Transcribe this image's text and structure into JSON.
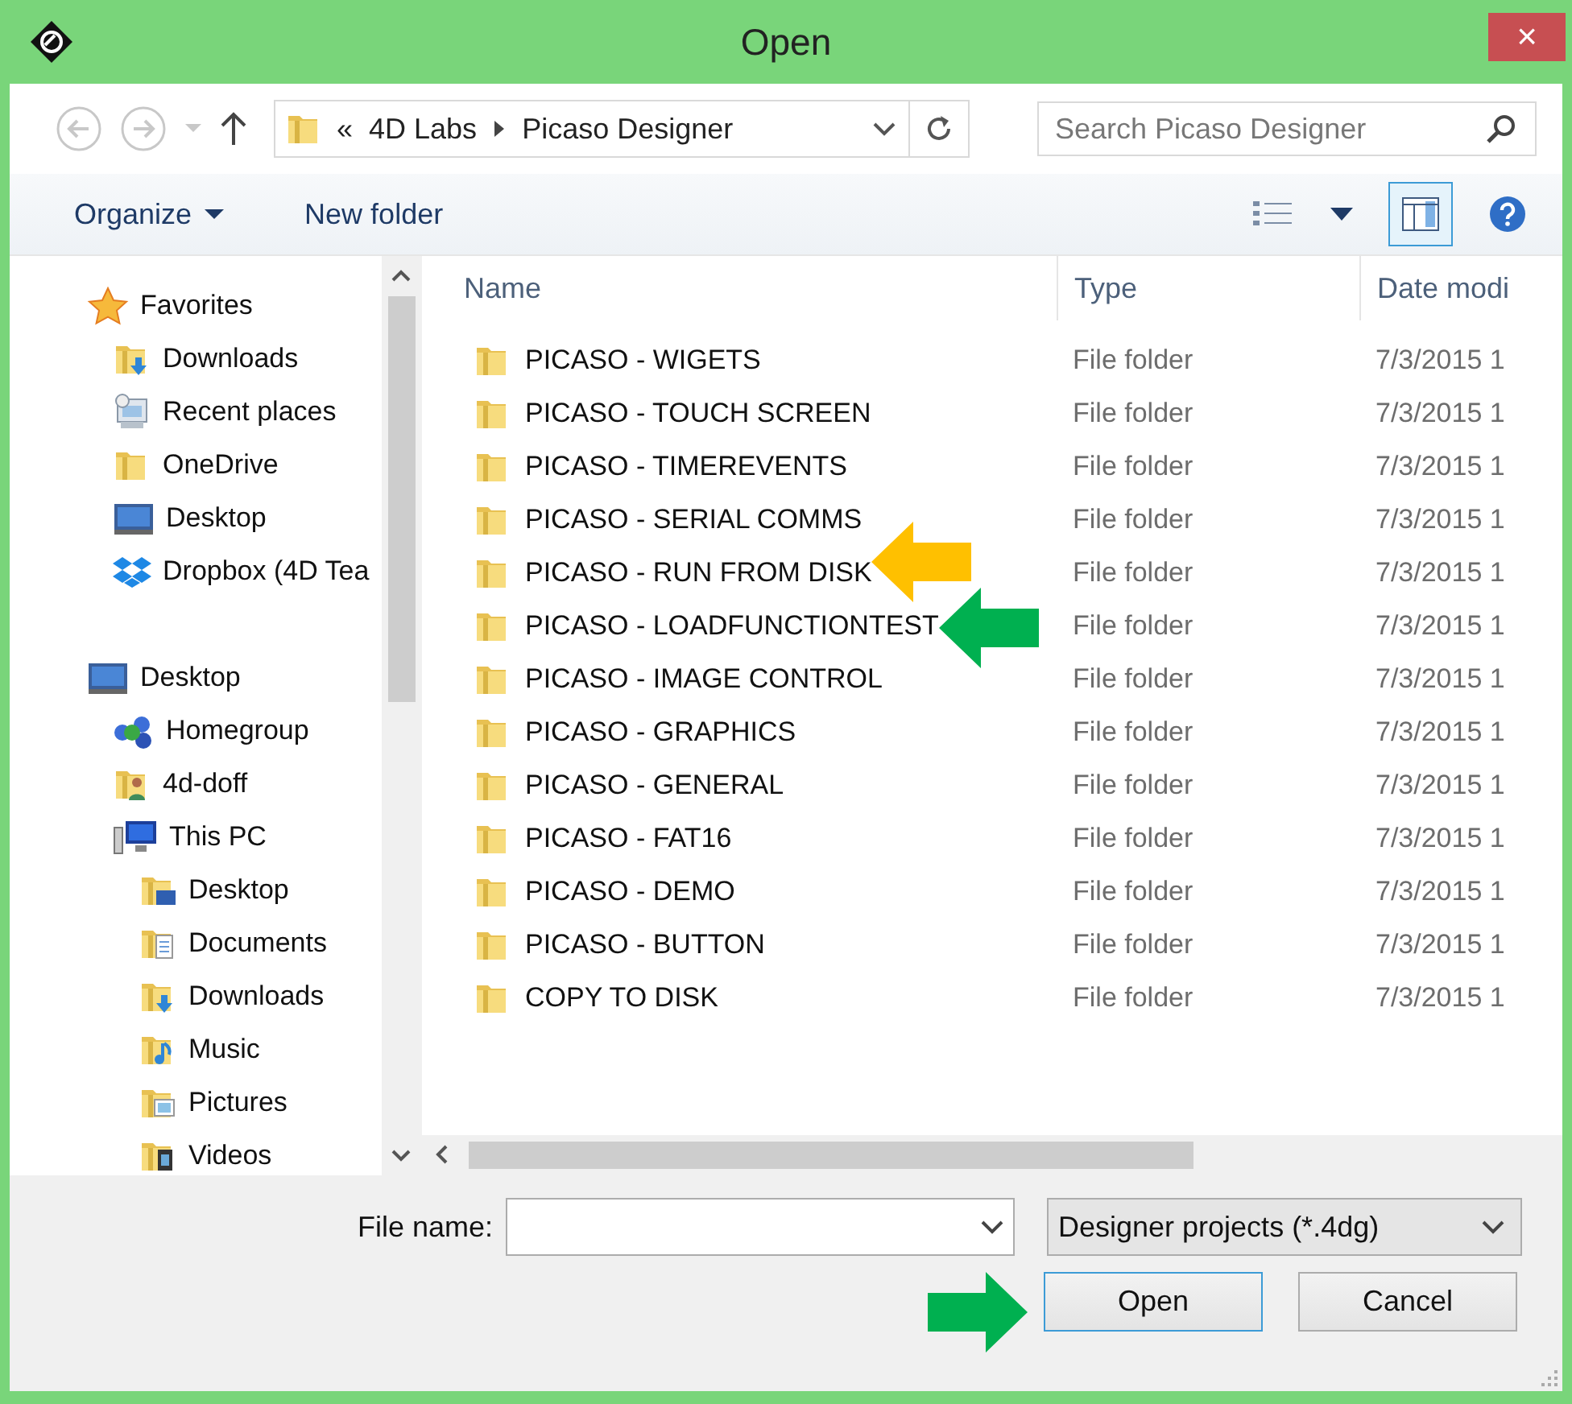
{
  "window": {
    "title": "Open",
    "close": "×"
  },
  "navigation": {
    "path": [
      "«",
      "4D Labs",
      "Picaso Designer"
    ],
    "search": {
      "placeholder": "Search Picaso Designer"
    }
  },
  "toolbar": {
    "items": [
      "Organize",
      "New folder"
    ]
  },
  "sidebar": {
    "items": [
      {
        "label": "Favorites",
        "kind": "star",
        "children": [
          {
            "label": "Downloads",
            "kind": "download"
          },
          {
            "label": "Recent places",
            "kind": "recent"
          },
          {
            "label": "OneDrive",
            "kind": "folder"
          },
          {
            "label": "Desktop",
            "kind": "monitor"
          },
          {
            "label": "Dropbox (4D Tea",
            "kind": "dropbox"
          }
        ]
      },
      {
        "label": "Desktop",
        "kind": "monitor",
        "children": [
          {
            "label": "Homegroup",
            "kind": "homegroup"
          },
          {
            "label": "4d-doff",
            "kind": "user"
          },
          {
            "label": "This PC",
            "kind": "pc",
            "children": [
              {
                "label": "Desktop",
                "kind": "monitor-folder"
              },
              {
                "label": "Documents",
                "kind": "documents"
              },
              {
                "label": "Downloads",
                "kind": "download"
              },
              {
                "label": "Music",
                "kind": "music"
              },
              {
                "label": "Pictures",
                "kind": "pictures"
              },
              {
                "label": "Videos",
                "kind": "videos"
              }
            ]
          }
        ]
      }
    ]
  },
  "table": {
    "columns": [
      "Name",
      "Type",
      "Date modi"
    ],
    "rows": [
      {
        "name": "PICASO - WIGETS",
        "type": "File folder",
        "date": "7/3/2015 1"
      },
      {
        "name": "PICASO - TOUCH SCREEN",
        "type": "File folder",
        "date": "7/3/2015 1"
      },
      {
        "name": "PICASO - TIMEREVENTS",
        "type": "File folder",
        "date": "7/3/2015 1"
      },
      {
        "name": "PICASO - SERIAL COMMS",
        "type": "File folder",
        "date": "7/3/2015 1"
      },
      {
        "name": "PICASO - RUN FROM DISK",
        "type": "File folder",
        "date": "7/3/2015 1",
        "arrow": {
          "color": "#ffc000"
        }
      },
      {
        "name": "PICASO - LOADFUNCTIONTEST",
        "type": "File folder",
        "date": "7/3/2015 1",
        "arrow": {
          "color": "#00b050"
        }
      },
      {
        "name": "PICASO - IMAGE CONTROL",
        "type": "File folder",
        "date": "7/3/2015 1"
      },
      {
        "name": "PICASO - GRAPHICS",
        "type": "File folder",
        "date": "7/3/2015 1"
      },
      {
        "name": "PICASO - GENERAL",
        "type": "File folder",
        "date": "7/3/2015 1"
      },
      {
        "name": "PICASO - FAT16",
        "type": "File folder",
        "date": "7/3/2015 1"
      },
      {
        "name": "PICASO - DEMO",
        "type": "File folder",
        "date": "7/3/2015 1"
      },
      {
        "name": "PICASO - BUTTON",
        "type": "File folder",
        "date": "7/3/2015 1"
      },
      {
        "name": "COPY TO DISK",
        "type": "File folder",
        "date": "7/3/2015 1"
      }
    ]
  },
  "footer": {
    "file_name_label": "File name:",
    "file_type": "Designer projects (*.4dg)",
    "buttons": [
      {
        "label": "Open",
        "default": true,
        "arrow": {
          "color": "#00b050"
        }
      },
      {
        "label": "Cancel",
        "default": false
      }
    ]
  }
}
